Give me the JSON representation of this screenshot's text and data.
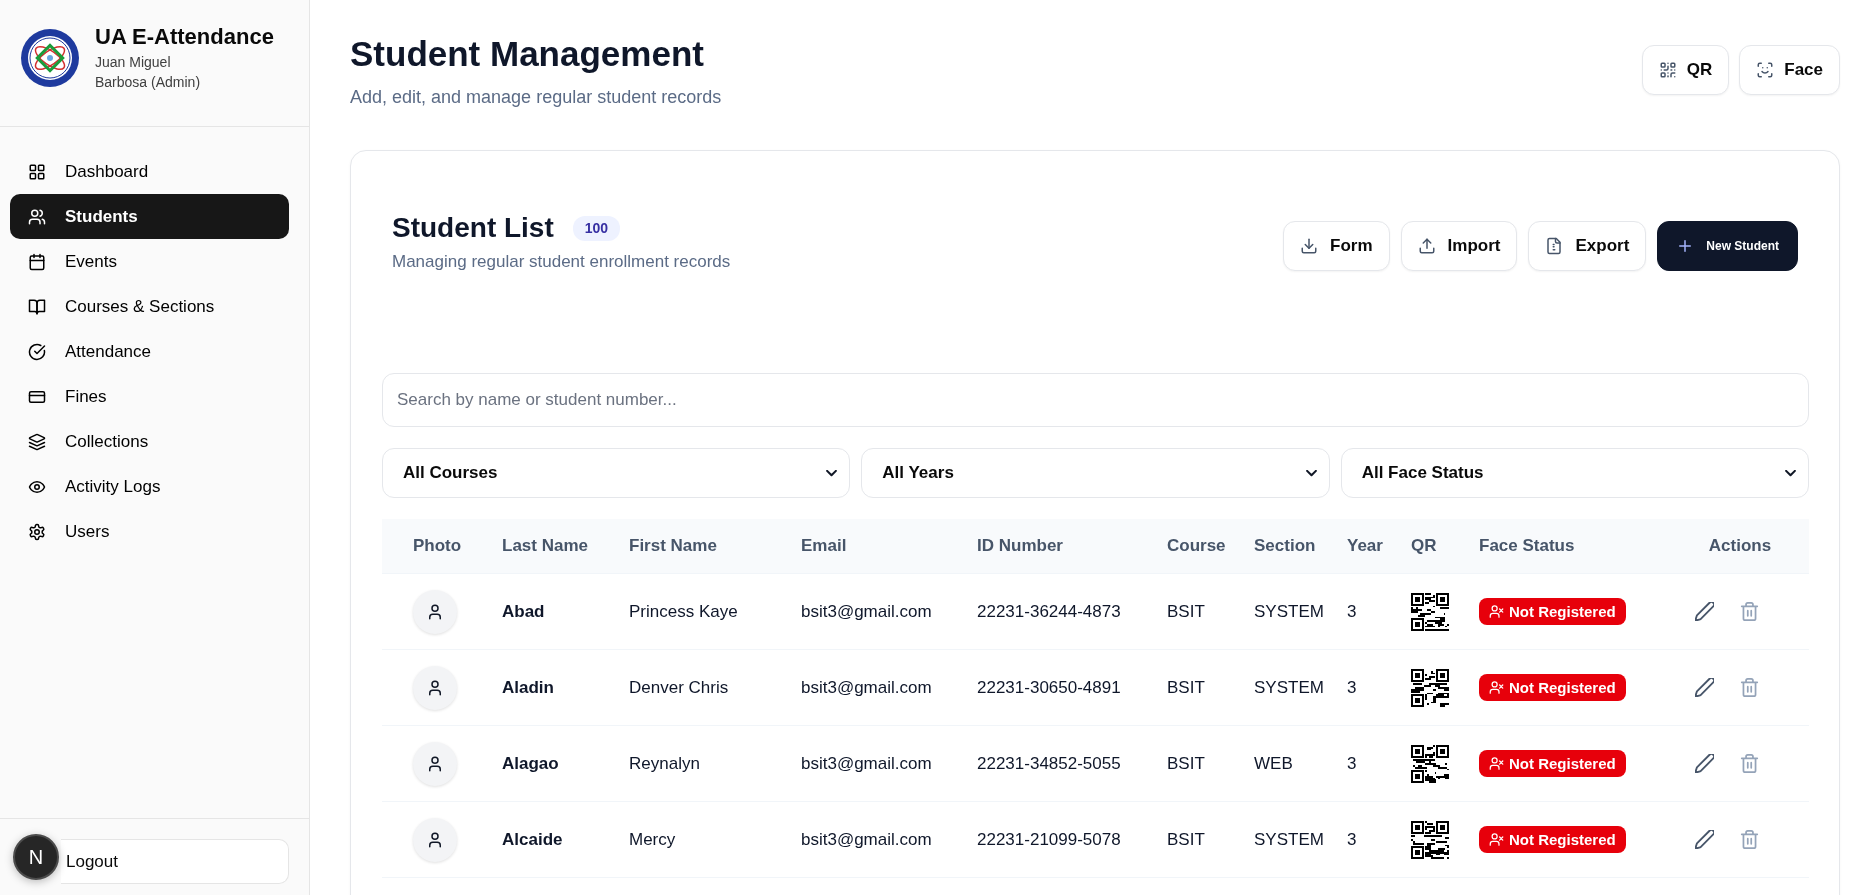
{
  "sidebar": {
    "app_title": "UA E-Attendance",
    "user": "Juan Miguel Barbosa (Admin)",
    "items": [
      {
        "label": "Dashboard",
        "selected": false
      },
      {
        "label": "Students",
        "selected": true
      },
      {
        "label": "Events",
        "selected": false
      },
      {
        "label": "Courses & Sections",
        "selected": false
      },
      {
        "label": "Attendance",
        "selected": false
      },
      {
        "label": "Fines",
        "selected": false
      },
      {
        "label": "Collections",
        "selected": false
      },
      {
        "label": "Activity Logs",
        "selected": false
      },
      {
        "label": "Users",
        "selected": false
      }
    ],
    "logout": "Logout"
  },
  "dev_indicator": {
    "label": "N"
  },
  "header": {
    "title": "Student Management",
    "subtitle": "Add, edit, and manage regular student records",
    "buttons": [
      {
        "label": "QR"
      },
      {
        "label": "Face"
      }
    ]
  },
  "card": {
    "title": "Student List",
    "count": "100",
    "subtitle": "Managing regular student enrollment records",
    "buttons": [
      {
        "label": "Form",
        "kind": "outline"
      },
      {
        "label": "Import",
        "kind": "outline"
      },
      {
        "label": "Export",
        "kind": "outline"
      },
      {
        "label": "New Student",
        "kind": "primary"
      }
    ]
  },
  "search": {
    "placeholder": "Search by name or student number..."
  },
  "filters": [
    {
      "value": "All Courses"
    },
    {
      "value": "All Years"
    },
    {
      "value": "All Face Status"
    }
  ],
  "table": {
    "columns": [
      "Photo",
      "Last Name",
      "First Name",
      "Email",
      "ID Number",
      "Course",
      "Section",
      "Year",
      "QR",
      "Face Status",
      "Actions"
    ],
    "rows": [
      {
        "last_name": "Abad",
        "first_name": "Princess Kaye",
        "email": "bsit3@gmail.com",
        "id_number": "22231-36244-4873",
        "course": "BSIT",
        "section": "SYSTEM",
        "year": "3",
        "face_status": "Not Registered",
        "face_registered": false
      },
      {
        "last_name": "Aladin",
        "first_name": "Denver Chris",
        "email": "bsit3@gmail.com",
        "id_number": "22231-30650-4891",
        "course": "BSIT",
        "section": "SYSTEM",
        "year": "3",
        "face_status": "Not Registered",
        "face_registered": false
      },
      {
        "last_name": "Alagao",
        "first_name": "Reynalyn",
        "email": "bsit3@gmail.com",
        "id_number": "22231-34852-5055",
        "course": "BSIT",
        "section": "WEB",
        "year": "3",
        "face_status": "Not Registered",
        "face_registered": false
      },
      {
        "last_name": "Alcaide",
        "first_name": "Mercy",
        "email": "bsit3@gmail.com",
        "id_number": "22231-21099-5078",
        "course": "BSIT",
        "section": "SYSTEM",
        "year": "3",
        "face_status": "Not Registered",
        "face_registered": false
      }
    ]
  }
}
